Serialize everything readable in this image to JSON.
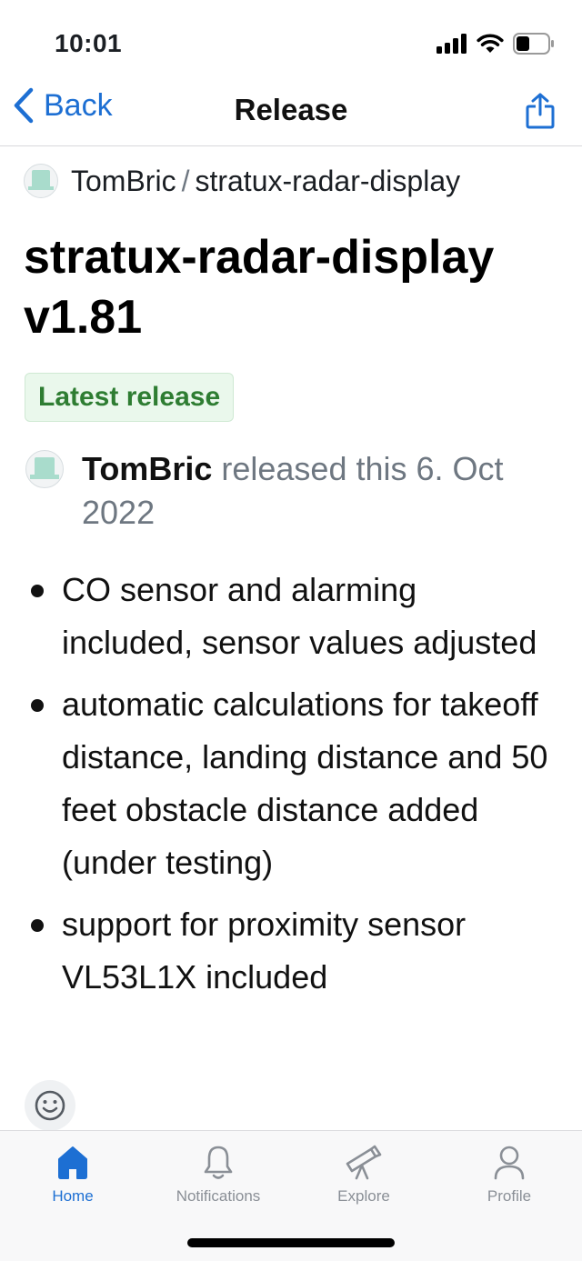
{
  "status_bar": {
    "time": "10:01"
  },
  "nav": {
    "back_label": "Back",
    "title": "Release"
  },
  "breadcrumb": {
    "owner": "TomBric",
    "separator": "/",
    "repo": "stratux-radar-display"
  },
  "release": {
    "title": "stratux-radar-display v1.81",
    "badge": "Latest release",
    "author": "TomBric",
    "released_text": "released this 6. Oct 2022",
    "notes": [
      "CO sensor and alarming included, sensor values adjusted",
      "automatic calculations for takeoff distance, landing distance and 50 feet obstacle distance added (under testing)",
      "support for proximity sensor VL53L1X included"
    ]
  },
  "tabs": [
    {
      "label": "Home",
      "icon": "home-icon",
      "active": true
    },
    {
      "label": "Notifications",
      "icon": "bell-icon",
      "active": false
    },
    {
      "label": "Explore",
      "icon": "telescope-icon",
      "active": false
    },
    {
      "label": "Profile",
      "icon": "person-icon",
      "active": false
    }
  ],
  "colors": {
    "accent": "#1d6fd3",
    "badge_green": "#2e7d32",
    "badge_bg": "#eaf8ec"
  }
}
